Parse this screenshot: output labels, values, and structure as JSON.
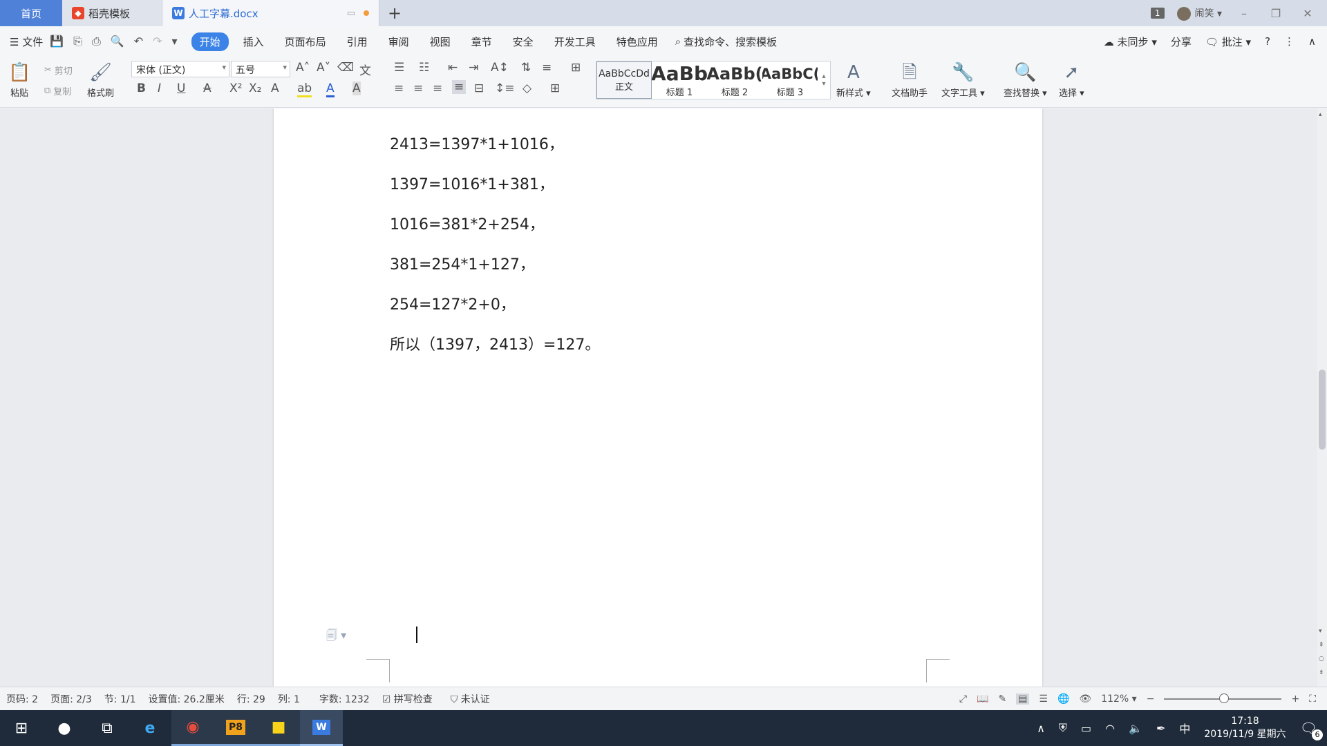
{
  "tabs": {
    "home": "首页",
    "template": "稻壳模板",
    "document": "人工字幕.docx",
    "add": "+"
  },
  "titlebar": {
    "window_count": "1",
    "user": "闹笑",
    "minimize": "–",
    "restore": "❐",
    "close": "✕"
  },
  "menu": {
    "file": "文件",
    "items": [
      "开始",
      "插入",
      "页面布局",
      "引用",
      "审阅",
      "视图",
      "章节",
      "安全",
      "开发工具",
      "特色应用"
    ],
    "search": "查找命令、搜索模板",
    "sync": "未同步",
    "share": "分享",
    "comment": "批注",
    "help": "?",
    "more": "⋮",
    "collapse": "∧"
  },
  "ribbon": {
    "paste": "粘贴",
    "cut": "剪切",
    "copy": "复制",
    "format_painter": "格式刷",
    "font_name": "宋体 (正文)",
    "font_size": "五号",
    "styles": [
      {
        "preview": "AaBbCcDd",
        "label": "正文"
      },
      {
        "preview": "AaBb",
        "label": "标题 1"
      },
      {
        "preview": "AaBb(",
        "label": "标题 2"
      },
      {
        "preview": "AaBbC(",
        "label": "标题 3"
      }
    ],
    "new_style": "新样式",
    "doc_assistant": "文档助手",
    "text_tools": "文字工具",
    "find_replace": "查找替换",
    "select": "选择"
  },
  "document": {
    "lines": [
      "2413=1397*1+1016，",
      "1397=1016*1+381，",
      "1016=381*2+254，",
      "381=254*1+127，",
      "254=127*2+0，",
      "所以（1397，2413）=127。"
    ]
  },
  "status": {
    "page_code": "页码: 2",
    "page": "页面: 2/3",
    "section": "节: 1/1",
    "position": "设置值: 26.2厘米",
    "row": "行: 29",
    "col": "列: 1",
    "word_count": "字数: 1232",
    "spell_check": "拼写检查",
    "auth": "未认证",
    "zoom": "112%"
  },
  "taskbar": {
    "time": "17:18",
    "date": "2019/11/9 星期六",
    "ime": "中",
    "notifications": "6"
  }
}
